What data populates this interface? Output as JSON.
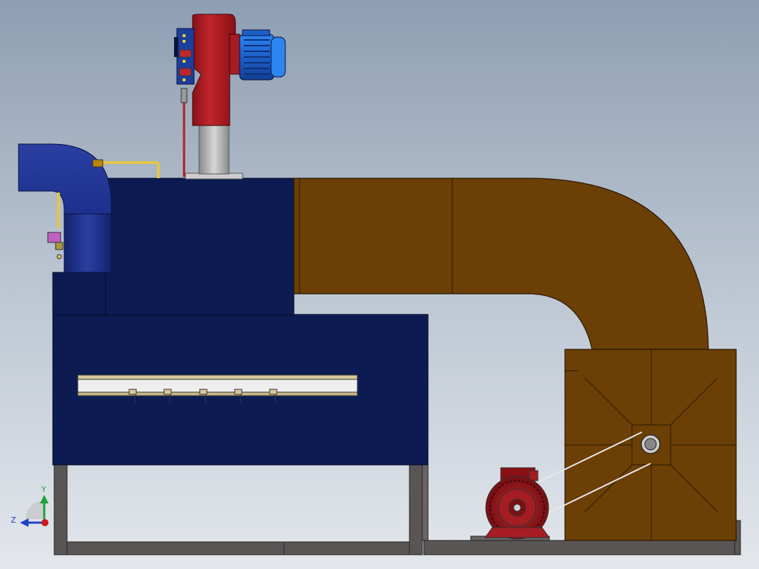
{
  "viewport": {
    "background_top": "#8e9eb2",
    "background_bottom": "#e3e7ec"
  },
  "model": {
    "components": [
      {
        "name": "burner-fan",
        "color": "#b01e24"
      },
      {
        "name": "burner-motor",
        "color": "#1f6fd8"
      },
      {
        "name": "burner-control-box",
        "color": "#1c3f9a"
      },
      {
        "name": "gas-train-pipe",
        "color": "#e2c64a"
      },
      {
        "name": "dryer-body",
        "color": "#0c1c52"
      },
      {
        "name": "inlet-elbow",
        "color": "#1b2f8c"
      },
      {
        "name": "exhaust-duct",
        "color": "#6b3f06"
      },
      {
        "name": "fan-housing",
        "color": "#6b3f06"
      },
      {
        "name": "drive-motor",
        "color": "#a51c22"
      },
      {
        "name": "base-frame",
        "color": "#5a5555"
      }
    ]
  },
  "triad": {
    "y_label": "Y",
    "z_label": "Z",
    "y_color": "#1fa23a",
    "z_color": "#2040c8",
    "origin_color": "#d01818"
  }
}
